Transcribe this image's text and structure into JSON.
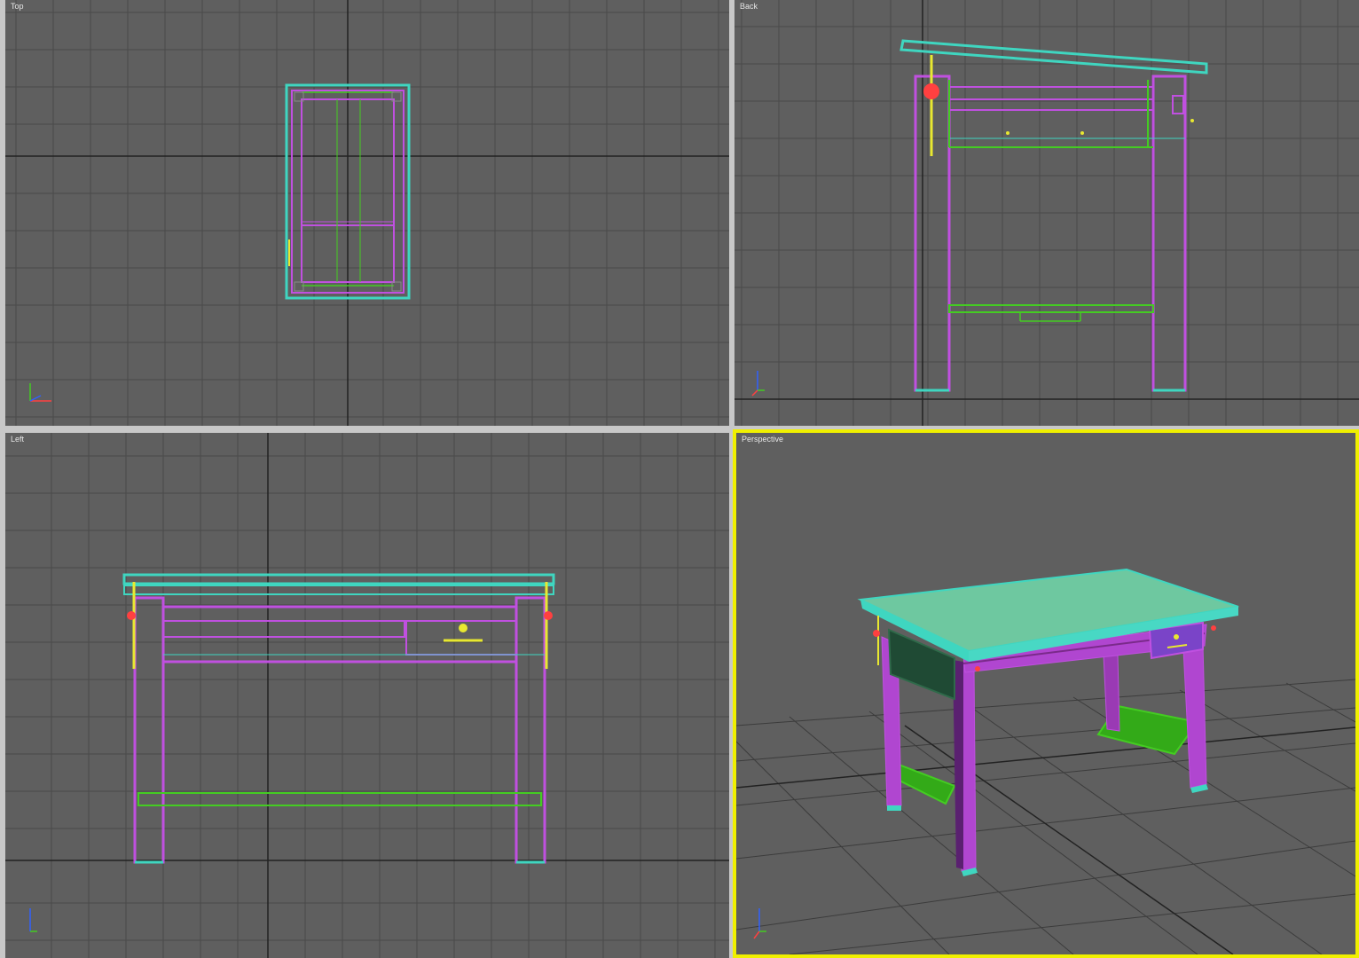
{
  "viewports": {
    "top": {
      "label": "Top"
    },
    "back": {
      "label": "Back"
    },
    "left": {
      "label": "Left"
    },
    "perspective": {
      "label": "Perspective",
      "active": true
    }
  },
  "colors": {
    "viewport_bg": "#5f5f5f",
    "grid": "#4a4a4a",
    "grid_major": "#222222",
    "separator": "#c8c8c8",
    "active_border": "#f0f000",
    "tabletop": "#3fd6c0",
    "tabletop_fill": "#6ec8a0",
    "legs": "#c050e0",
    "legs_dark": "#7a2a8a",
    "stretcher": "#44cc22",
    "drawer": "#1f4a34",
    "handle": "#e8e830",
    "marker": "#ff4040"
  },
  "icons": [
    "axis-tripod-icon"
  ]
}
